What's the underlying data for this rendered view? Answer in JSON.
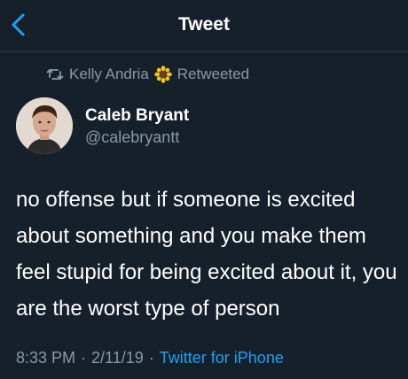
{
  "nav": {
    "title": "Tweet",
    "back_icon": "chevron-left-icon"
  },
  "retweet": {
    "icon": "retweet-icon",
    "user": "Kelly Andria",
    "emoji_icon": "sunflower-icon",
    "label": "Retweeted"
  },
  "tweet": {
    "author_name": "Caleb Bryant",
    "author_handle": "@calebryantt",
    "text": "no offense but if someone is excited about something and you make them feel stupid for being excited about it, you are the worst type of person",
    "time": "8:33 PM",
    "date": "2/11/19",
    "separator": "·",
    "source": "Twitter for iPhone"
  },
  "colors": {
    "background": "#15202b",
    "accent": "#1da1f2",
    "muted": "#8899a6",
    "text": "#ffffff"
  }
}
